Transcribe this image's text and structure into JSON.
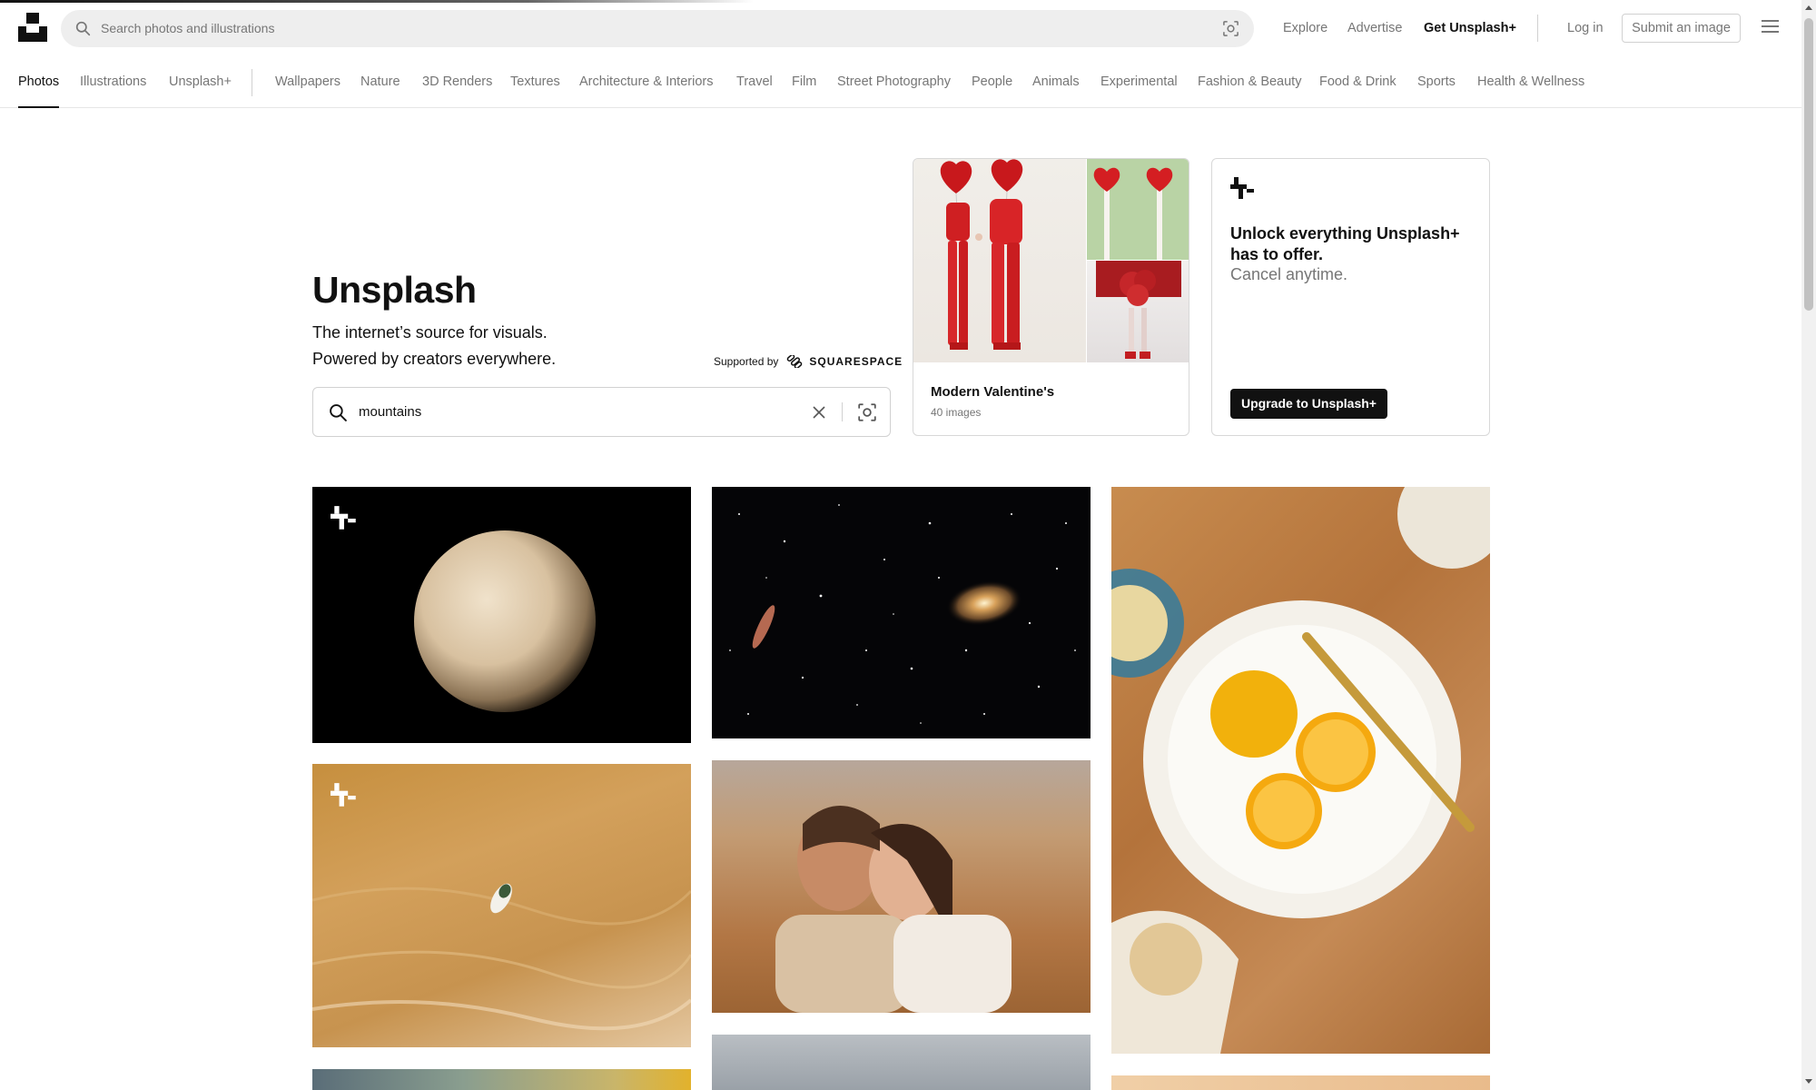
{
  "header": {
    "search_placeholder": "Search photos and illustrations",
    "nav": {
      "explore": "Explore",
      "advertise": "Advertise",
      "get_plus": "Get Unsplash+",
      "login": "Log in",
      "submit": "Submit an image"
    }
  },
  "tabs": {
    "primary": [
      "Photos",
      "Illustrations",
      "Unsplash+"
    ],
    "topics": [
      "Wallpapers",
      "Nature",
      "3D Renders",
      "Textures",
      "Architecture & Interiors",
      "Travel",
      "Film",
      "Street Photography",
      "People",
      "Animals",
      "Experimental",
      "Fashion & Beauty",
      "Food & Drink",
      "Sports",
      "Health & Wellness"
    ],
    "active": "Photos"
  },
  "hero": {
    "title": "Unsplash",
    "line1": "The internet’s source for visuals.",
    "line2": "Powered by creators everywhere.",
    "supported_by": "Supported by",
    "sponsor": "SQUARESPACE",
    "search_value": "mountains"
  },
  "collection": {
    "title": "Modern Valentine's",
    "count": "40 images"
  },
  "plus_promo": {
    "line1": "Unlock everything Unsplash+ has to offer.",
    "line2": "Cancel anytime.",
    "button": "Upgrade to Unsplash+"
  },
  "colors": {
    "text_primary": "#111111",
    "text_secondary": "#767676",
    "border": "#d1d1d1",
    "search_bg": "#eeeeee"
  },
  "photos": [
    {
      "subject": "planet on black background",
      "plus": true
    },
    {
      "subject": "galaxies in starfield",
      "plus": false
    },
    {
      "subject": "lemons on white plate on wooden table",
      "plus": false
    },
    {
      "subject": "aerial boat on sand-colored water",
      "plus": true
    },
    {
      "subject": "couple embracing in warm light",
      "plus": false
    }
  ]
}
